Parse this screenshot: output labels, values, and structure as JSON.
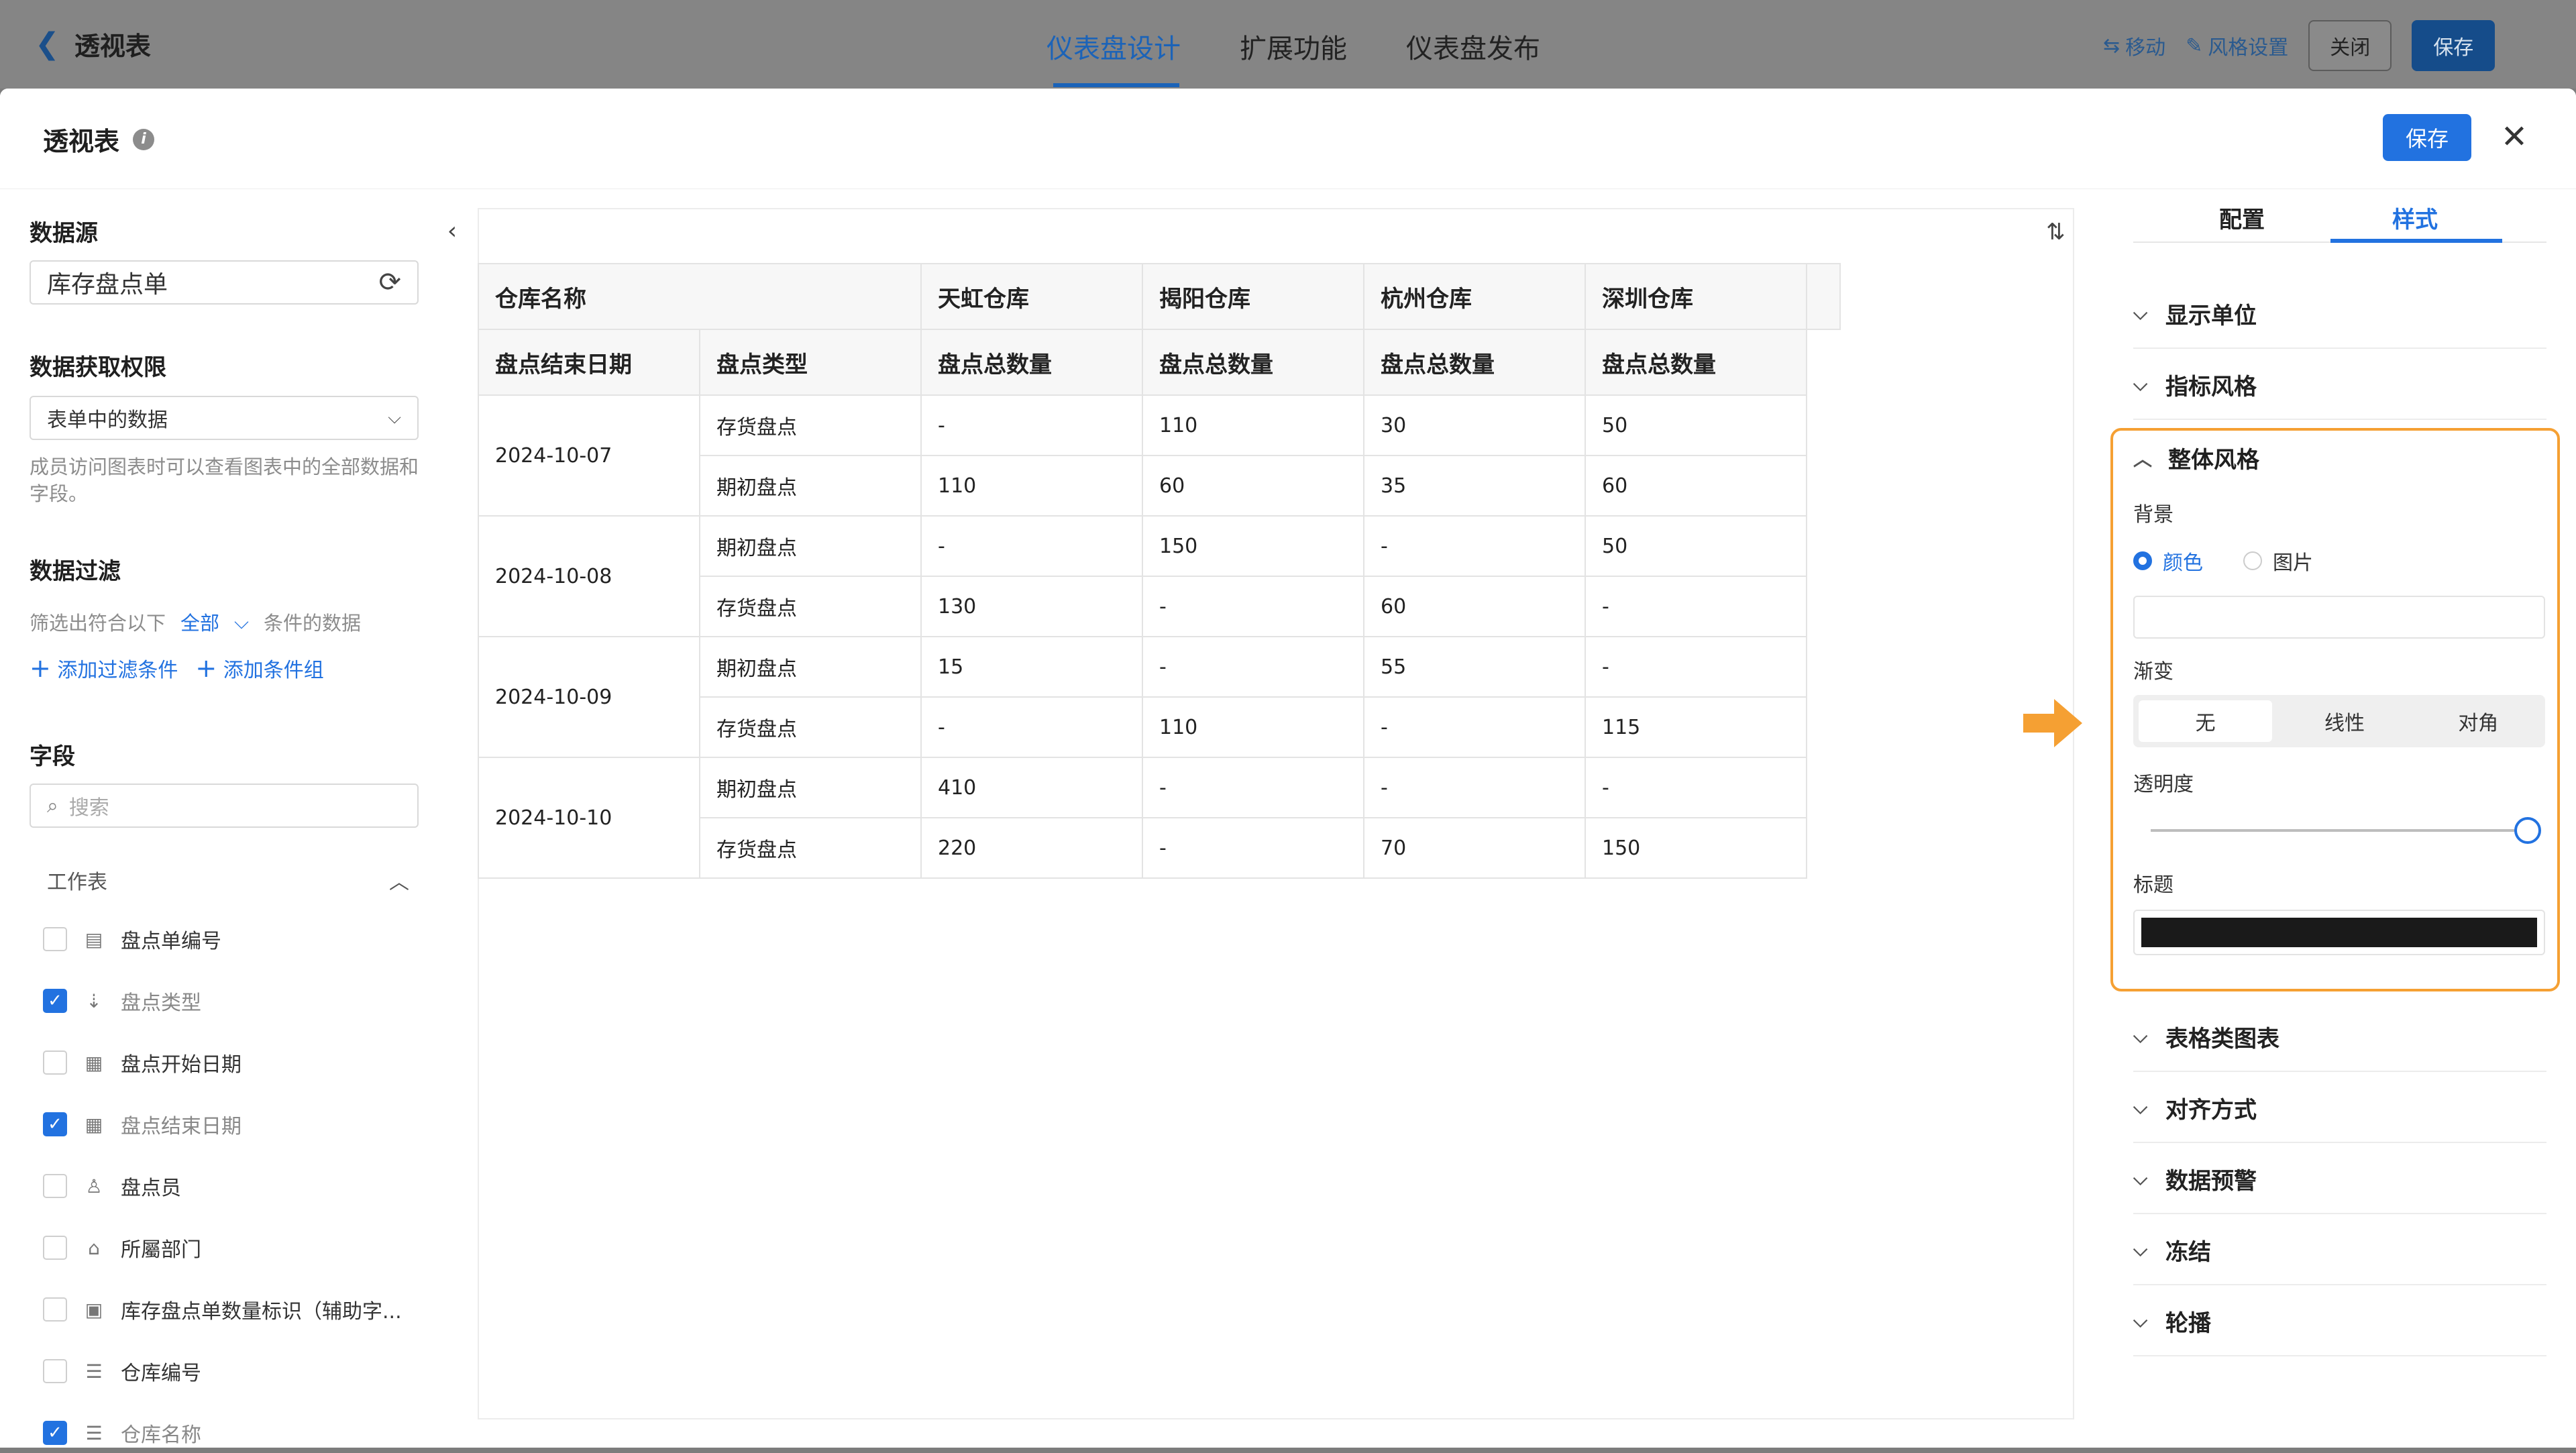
{
  "topbar": {
    "back_title": "透视表",
    "tabs": [
      "仪表盘设计",
      "扩展功能",
      "仪表盘发布"
    ],
    "move_label": "移动",
    "style_settings_label": "风格设置",
    "close_label": "关闭",
    "save_label": "保存"
  },
  "modal": {
    "title": "透视表",
    "save_label": "保存"
  },
  "left": {
    "datasource_label": "数据源",
    "datasource_value": "库存盘点单",
    "permission_label": "数据获取权限",
    "permission_value": "表单中的数据",
    "permission_hint": "成员访问图表时可以查看图表中的全部数据和字段。",
    "filter_label": "数据过滤",
    "filter_prefix": "筛选出符合以下",
    "filter_scope": "全部",
    "filter_suffix": "条件的数据",
    "add_filter": "添加过滤条件",
    "add_group": "添加条件组",
    "fields_label": "字段",
    "search_placeholder": "搜索",
    "group_label": "工作表",
    "fields": [
      {
        "name": "盘点单编号",
        "checked": false,
        "icon": "doc-icon"
      },
      {
        "name": "盘点类型",
        "checked": true,
        "icon": "sort-list-icon"
      },
      {
        "name": "盘点开始日期",
        "checked": false,
        "icon": "calendar-icon"
      },
      {
        "name": "盘点结束日期",
        "checked": true,
        "icon": "calendar-icon"
      },
      {
        "name": "盘点员",
        "checked": false,
        "icon": "user-icon"
      },
      {
        "name": "所屬部门",
        "checked": false,
        "icon": "building-icon"
      },
      {
        "name": "库存盘点单数量标识（辅助字...",
        "checked": false,
        "icon": "number-icon"
      },
      {
        "name": "仓库编号",
        "checked": false,
        "icon": "text-lines-icon"
      },
      {
        "name": "仓库名称",
        "checked": true,
        "icon": "text-lines-icon"
      }
    ]
  },
  "table": {
    "header1": [
      "仓库名称",
      "天虹仓库",
      "揭阳仓库",
      "杭州仓库",
      "深圳仓库"
    ],
    "header2": [
      "盘点结束日期",
      "盘点类型",
      "盘点总数量",
      "盘点总数量",
      "盘点总数量",
      "盘点总数量"
    ],
    "groups": [
      {
        "date": "2024-10-07",
        "rows": [
          {
            "type": "存货盘点",
            "vals": [
              "-",
              "110",
              "30",
              "50"
            ]
          },
          {
            "type": "期初盘点",
            "vals": [
              "110",
              "60",
              "35",
              "60"
            ]
          }
        ]
      },
      {
        "date": "2024-10-08",
        "rows": [
          {
            "type": "期初盘点",
            "vals": [
              "-",
              "150",
              "-",
              "50"
            ]
          },
          {
            "type": "存货盘点",
            "vals": [
              "130",
              "-",
              "60",
              "-"
            ]
          }
        ]
      },
      {
        "date": "2024-10-09",
        "rows": [
          {
            "type": "期初盘点",
            "vals": [
              "15",
              "-",
              "55",
              "-"
            ]
          },
          {
            "type": "存货盘点",
            "vals": [
              "-",
              "110",
              "-",
              "115"
            ]
          }
        ]
      },
      {
        "date": "2024-10-10",
        "rows": [
          {
            "type": "期初盘点",
            "vals": [
              "410",
              "-",
              "-",
              "-"
            ]
          },
          {
            "type": "存货盘点",
            "vals": [
              "220",
              "-",
              "70",
              "150"
            ]
          }
        ]
      }
    ]
  },
  "right": {
    "tab_config": "配置",
    "tab_style": "样式",
    "sec_display_unit": "显示单位",
    "sec_indicator_style": "指标风格",
    "sec_overall_style": "整体风格",
    "background_label": "背景",
    "radio_color": "颜色",
    "radio_image": "图片",
    "gradient_label": "渐变",
    "gradient_options": [
      "无",
      "线性",
      "对角"
    ],
    "opacity_label": "透明度",
    "opacity_value": 1.0,
    "title_label": "标题",
    "title_color": "#1a1a1a",
    "sections_below": [
      "表格类图表",
      "对齐方式",
      "数据预警",
      "冻结",
      "轮播"
    ]
  },
  "colors": {
    "accent": "#2272e0",
    "highlight": "#f5a033"
  }
}
